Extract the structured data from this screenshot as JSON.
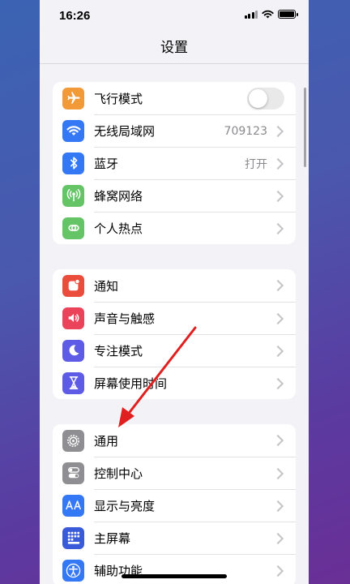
{
  "status_bar": {
    "time": "16:26"
  },
  "nav": {
    "title": "设置"
  },
  "groups": [
    {
      "items": [
        {
          "label": "飞行模式",
          "icon": "airplane-icon",
          "color": "#f19a37",
          "toggle": "off"
        },
        {
          "label": "无线局域网",
          "value": "709123",
          "icon": "wifi-icon",
          "color": "#3478f6"
        },
        {
          "label": "蓝牙",
          "value": "打开",
          "icon": "bluetooth-icon",
          "color": "#3478f6"
        },
        {
          "label": "蜂窝网络",
          "icon": "cellular-icon",
          "color": "#65c466"
        },
        {
          "label": "个人热点",
          "icon": "hotspot-icon",
          "color": "#65c466"
        }
      ]
    },
    {
      "items": [
        {
          "label": "通知",
          "icon": "notification-icon",
          "color": "#eb4d3d"
        },
        {
          "label": "声音与触感",
          "icon": "speaker-icon",
          "color": "#eb445a"
        },
        {
          "label": "专注模式",
          "icon": "moon-icon",
          "color": "#5e5ce6"
        },
        {
          "label": "屏幕使用时间",
          "icon": "hourglass-icon",
          "color": "#5e5ce6"
        }
      ]
    },
    {
      "items": [
        {
          "label": "通用",
          "icon": "gear-icon",
          "color": "#8e8e93"
        },
        {
          "label": "控制中心",
          "icon": "switches-icon",
          "color": "#8e8e93"
        },
        {
          "label": "显示与亮度",
          "icon": "text-size-icon",
          "color": "#3478f6"
        },
        {
          "label": "主屏幕",
          "icon": "home-grid-icon",
          "color": "#3a5bd9"
        },
        {
          "label": "辅助功能",
          "icon": "accessibility-icon",
          "color": "#3478f6"
        }
      ]
    }
  ],
  "annotation": {
    "type": "red-arrow",
    "target": "通用",
    "color": "#e02020"
  }
}
